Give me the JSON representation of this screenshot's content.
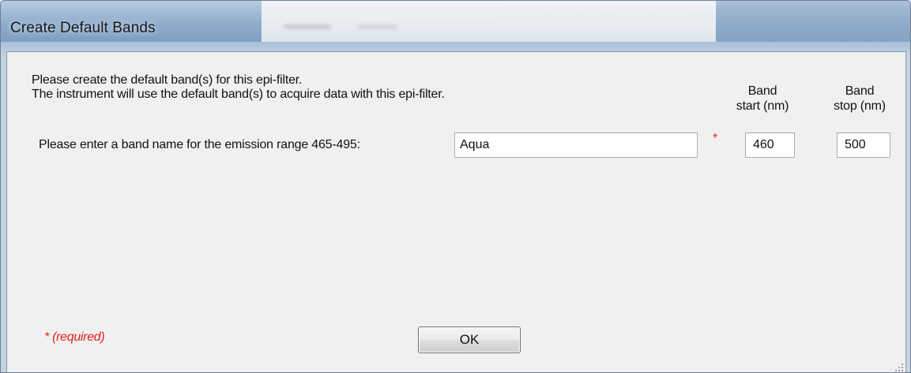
{
  "window": {
    "title": "Create Default Bands"
  },
  "instructions": {
    "line1": "Please create the default band(s) for this epi-filter.",
    "line2": "The instrument will use the default band(s) to acquire data with this epi-filter."
  },
  "columns": {
    "band_start": "Band\nstart (nm)",
    "band_stop": "Band\nstop (nm)"
  },
  "band_row": {
    "prompt": "Please enter a band name for the emission range 465-495:",
    "band_name_value": "Aqua",
    "required_marker": "*",
    "band_start_value": "460",
    "band_stop_value": "500"
  },
  "footer": {
    "required_note": "* (required)",
    "ok_label": "OK"
  },
  "colors": {
    "required": "#e02020",
    "dialog_background": "#f0f0f0"
  }
}
